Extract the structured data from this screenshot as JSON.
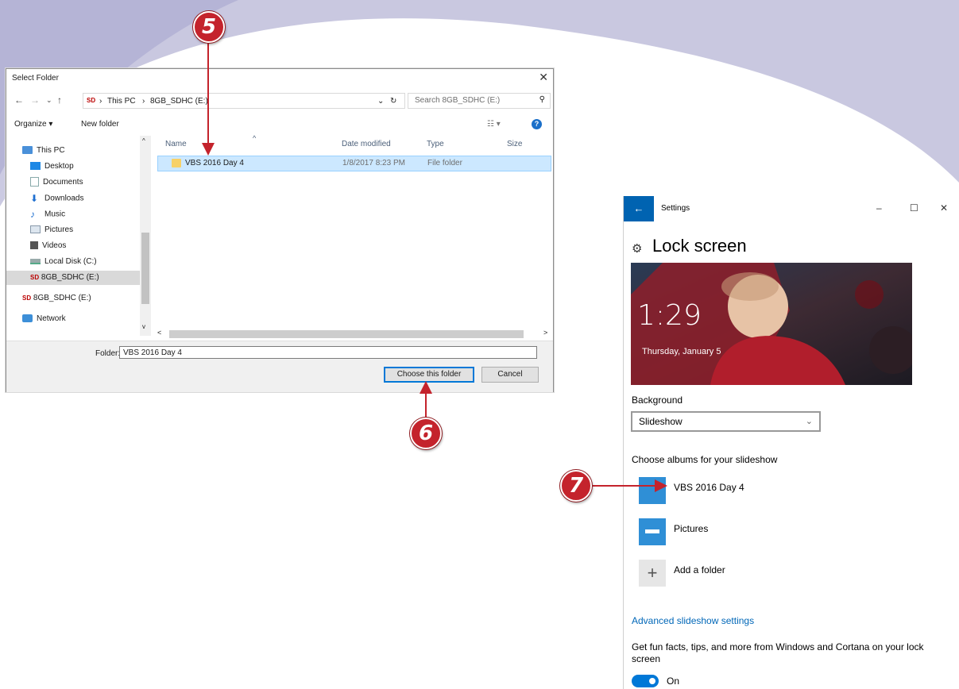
{
  "dialog": {
    "title": "Select Folder",
    "close_glyph": "✕",
    "breadcrumb": {
      "sd_label": "SD",
      "root": "This PC",
      "drive": "8GB_SDHC (E:)",
      "sep": "›"
    },
    "search_placeholder": "Search 8GB_SDHC (E:)",
    "toolbar": {
      "organize": "Organize ▾",
      "new_folder": "New folder",
      "help": "?"
    },
    "nav_items": [
      {
        "label": "This PC",
        "icon": "computer-icon"
      },
      {
        "label": "Desktop",
        "icon": "desktop-icon"
      },
      {
        "label": "Documents",
        "icon": "documents-icon"
      },
      {
        "label": "Downloads",
        "icon": "downloads-icon"
      },
      {
        "label": "Music",
        "icon": "music-icon"
      },
      {
        "label": "Pictures",
        "icon": "pictures-icon"
      },
      {
        "label": "Videos",
        "icon": "videos-icon"
      },
      {
        "label": "Local Disk (C:)",
        "icon": "local-disk-icon"
      },
      {
        "label": "8GB_SDHC (E:)",
        "icon": "sd-card-icon",
        "selected": true
      },
      {
        "label": "8GB_SDHC (E:)",
        "icon": "sd-card-icon"
      },
      {
        "label": "Network",
        "icon": "network-icon"
      }
    ],
    "columns": {
      "name": "Name",
      "date": "Date modified",
      "type": "Type",
      "size": "Size"
    },
    "rows": [
      {
        "name": "VBS 2016 Day 4",
        "date": "1/8/2017 8:23 PM",
        "type": "File folder",
        "size": ""
      }
    ],
    "folder_label": "Folder:",
    "folder_value": "VBS 2016 Day 4",
    "choose_button": "Choose this folder",
    "cancel_button": "Cancel"
  },
  "settings": {
    "window_title": "Settings",
    "back_glyph": "←",
    "minimize_glyph": "–",
    "maximize_glyph": "☐",
    "close_glyph": "✕",
    "page_title": "Lock screen",
    "lock_time": "1:29",
    "lock_date": "Thursday, January 5",
    "background_label": "Background",
    "background_value": "Slideshow",
    "albums_label": "Choose albums for your slideshow",
    "albums": [
      {
        "name": "VBS 2016 Day 4",
        "icon": "album-folder-icon"
      },
      {
        "name": "Pictures",
        "icon": "pictures-folder-icon"
      },
      {
        "name": "Add a folder",
        "icon": "add-icon"
      }
    ],
    "advanced_link": "Advanced slideshow settings",
    "fun_facts_text": "Get fun facts, tips, and more from Windows and Cortana on your lock screen",
    "toggle_state": "On"
  },
  "callouts": {
    "step5": "5",
    "step6": "6",
    "step7": "7"
  },
  "colors": {
    "accent": "#0078d7",
    "callout": "#c4232c",
    "selection": "#cce8ff",
    "sweep": "#c9c8e0"
  }
}
